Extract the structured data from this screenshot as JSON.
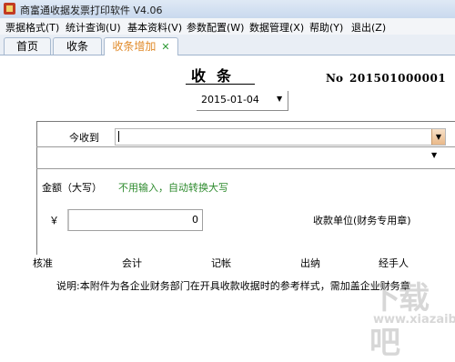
{
  "window": {
    "title": "商富通收据发票打印软件 V4.06"
  },
  "menu": {
    "items": [
      "票据格式(T)",
      "统计查询(U)",
      "基本资料(V)",
      "参数配置(W)",
      "数据管理(X)",
      "帮助(Y)",
      "退出(Z)"
    ]
  },
  "tabs": [
    {
      "label": "首页"
    },
    {
      "label": "收条"
    },
    {
      "label": "收条增加",
      "active": true,
      "close": "✕"
    }
  ],
  "receipt": {
    "title": "收条",
    "no_label": "No",
    "no_value": "201501000001",
    "date": "2015-01-04",
    "payer_label": "今收到",
    "payer_value": "",
    "amount_label": "金额（大写）",
    "amount_placeholder": "不用输入，自动转换大写",
    "currency_symbol": "￥",
    "amount_value": "0",
    "payee_unit_label": "收款单位(财务专用章)",
    "signatures": [
      "核准",
      "会计",
      "记帐",
      "出纳",
      "经手人"
    ],
    "note": "说明:本附件为各企业财务部门在开具收款收据时的参考样式，需加盖企业财务章"
  },
  "watermark": {
    "mark": "下载吧",
    "text": "www.xiazaiba.com"
  },
  "colors": {
    "hint_green": "#2e8b2e",
    "tab_active": "#e08a2a",
    "tab_close": "#2f9a36"
  }
}
